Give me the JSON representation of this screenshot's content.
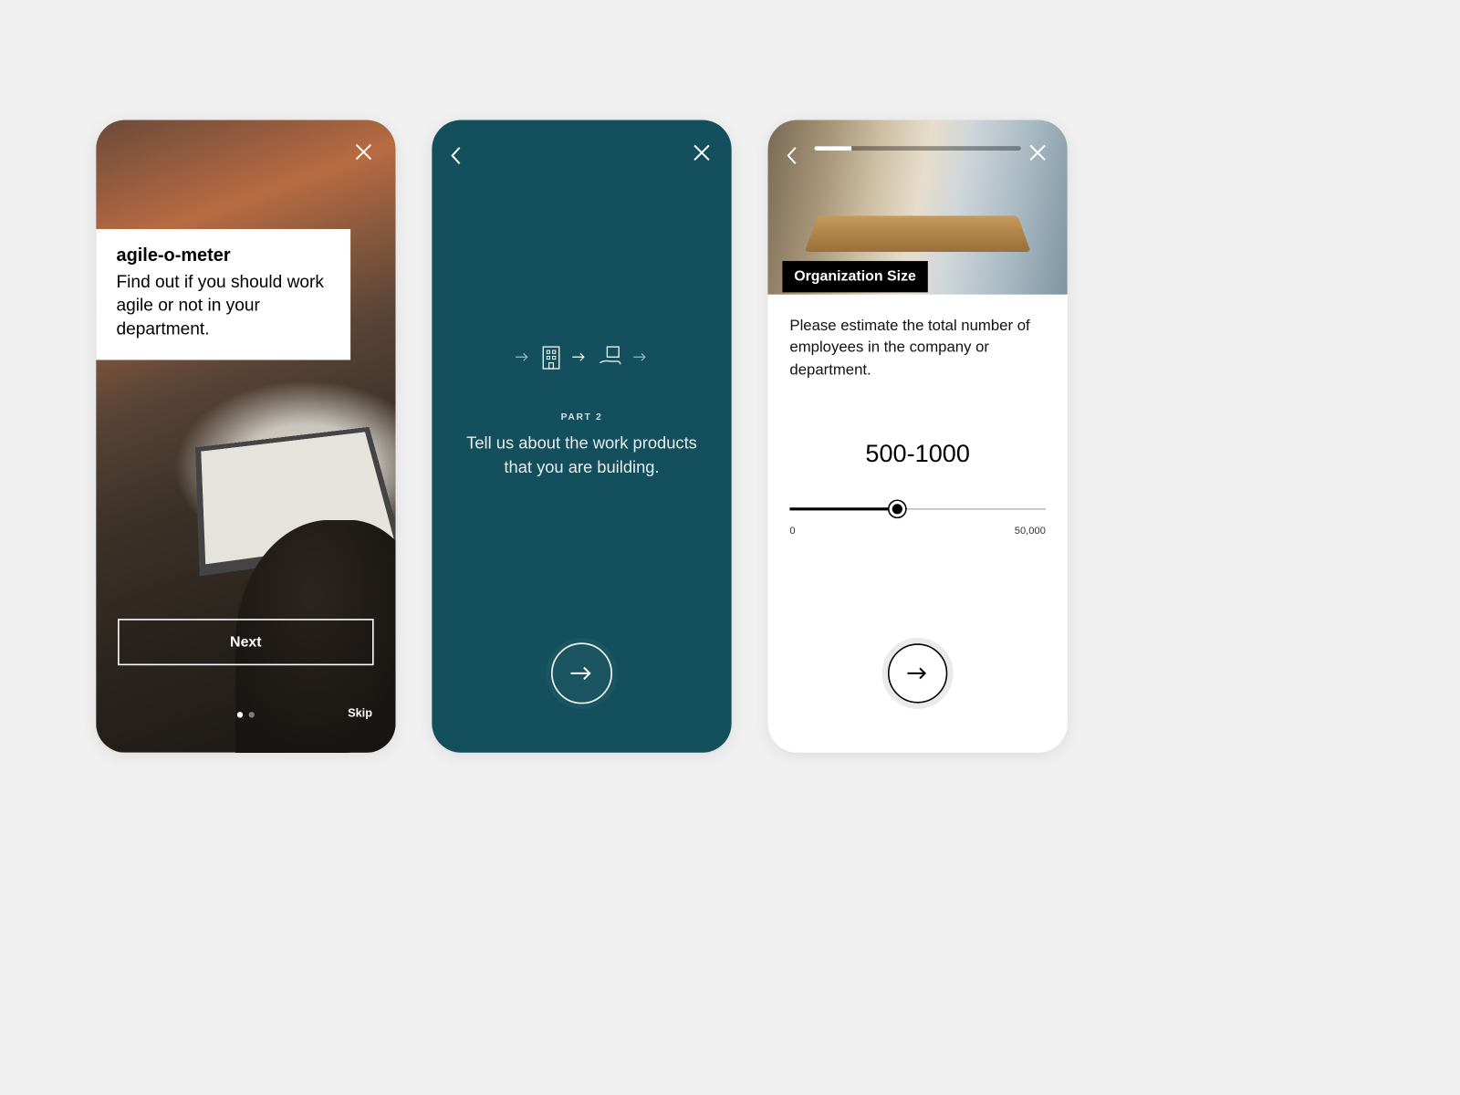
{
  "screen1": {
    "title": "agile-o-meter",
    "subtitle": "Find out if you should work agile or not in your department.",
    "next_label": "Next",
    "skip_label": "Skip",
    "page_index": 0,
    "page_count": 2
  },
  "screen2": {
    "part_label": "PART 2",
    "prompt": "Tell us about the work products that you are building."
  },
  "screen3": {
    "section_title": "Organization Size",
    "question": "Please estimate the total number of employees in the company or department.",
    "value_label": "500-1000",
    "min_label": "0",
    "max_label": "50,000",
    "slider_fraction": 0.42,
    "progress_fraction": 0.18
  },
  "colors": {
    "teal": "#134f5c",
    "black": "#000000",
    "white": "#ffffff"
  }
}
